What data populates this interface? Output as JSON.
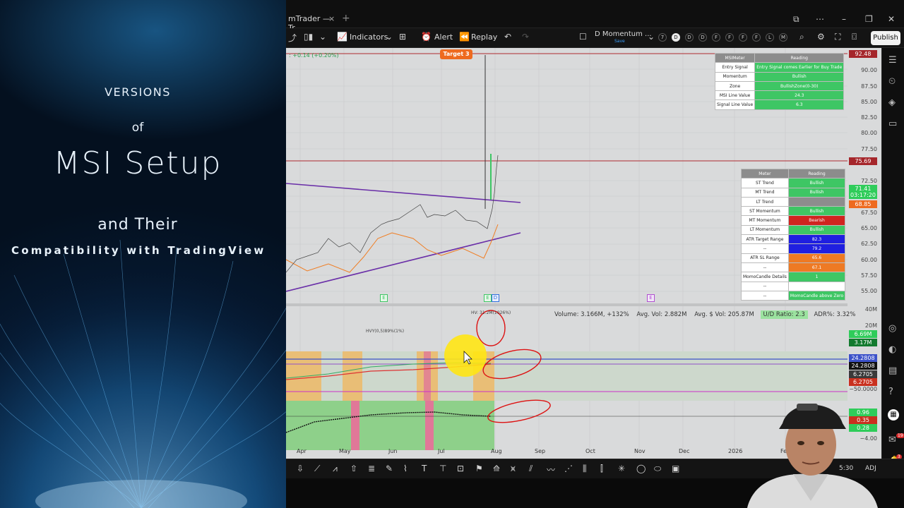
{
  "promo": {
    "line1": "VERSIONS",
    "line2": "of",
    "title": "MSI Setup",
    "line3": "and  Their",
    "line4": "Compatibility with TradingView"
  },
  "window": {
    "tab_title": "mTrader — Tr",
    "tab_close": "×",
    "new_tab": "+"
  },
  "toolbar": {
    "indicators_label": "Indicators",
    "alert_label": "Alert",
    "replay_label": "Replay",
    "layout_name": "D Momentum ...",
    "layout_sub": "Save",
    "timeframes": [
      "7",
      "D",
      "D",
      "D",
      "F",
      "F",
      "F",
      "F",
      "L",
      "M",
      "M"
    ],
    "publish_label": "Publish"
  },
  "chart": {
    "change_label": ": +0.14 (+0.20%)",
    "target_label": "Target 3",
    "price_scale": [
      "90.00",
      "87.50",
      "85.00",
      "82.50",
      "80.00",
      "77.50",
      "72.50",
      "67.50",
      "65.00",
      "62.50",
      "60.00",
      "57.50",
      "55.00"
    ],
    "price_tags": [
      {
        "text": "92.48",
        "color": "#a5262b"
      },
      {
        "text": "75.69",
        "color": "#a5262b"
      },
      {
        "text": "71.41",
        "color": "#2fcc5a"
      },
      {
        "text": "03:17:20",
        "color": "#2fcc5a"
      },
      {
        "text": "68.85",
        "color": "#ee6a1f"
      }
    ],
    "event_markers": [
      "E",
      "E",
      "D",
      "E"
    ],
    "volume_info": {
      "volume": "Volume: 3.166M, +132%",
      "avg_vol": "Avg. Vol: 2.882M",
      "avg_dollar": "Avg. $ Vol: 205.87M",
      "ud_ratio": "U/D Ratio: 2.3",
      "adr": "ADR%: 3.32%"
    },
    "hv_label_1": "HV: 31.2M(1026%)",
    "hv_label_2": "HVY(0,5)89%(1%)",
    "vol_scale": [
      "40M",
      "20M"
    ],
    "vol_tags": [
      "6.69M",
      "3.17M"
    ],
    "osc_tags": [
      "24.2808",
      "24.2808",
      "6.2705",
      "6.2705"
    ],
    "osc_scale": [
      "−50.0000"
    ],
    "osc2_tags": [
      "0.96",
      "0.35",
      "0.28"
    ],
    "osc2_scale": [
      "−4.00"
    ],
    "months": [
      "Apr",
      "May",
      "Jun",
      "Jul",
      "Aug",
      "Sep",
      "Oct",
      "Nov",
      "Dec",
      "2026",
      "Fe"
    ],
    "bottom_right": [
      "5:30",
      "ADJ"
    ]
  },
  "msimeter": {
    "header": [
      "MSIMeter",
      "Reading"
    ],
    "rows": [
      {
        "k": "Entry Signal",
        "v": "Entry Signal comes Earlier for Buy Trade",
        "c": "g"
      },
      {
        "k": "Momentum",
        "v": "Bullish",
        "c": "g"
      },
      {
        "k": "Zone",
        "v": "BullishZone(0-30)",
        "c": "g"
      },
      {
        "k": "MSI Line Value",
        "v": "24.3",
        "c": "g"
      },
      {
        "k": "Signal Line Value",
        "v": "6.3",
        "c": "g"
      }
    ]
  },
  "meter": {
    "header": [
      "Meter",
      "Reading"
    ],
    "rows": [
      {
        "k": "ST Trend",
        "v": "Bullish",
        "c": "g"
      },
      {
        "k": "MT Trend",
        "v": "Bullish",
        "c": "g"
      },
      {
        "k": "LT Trend",
        "v": "",
        "c": "gr"
      },
      {
        "k": "ST Momentum",
        "v": "Bullish",
        "c": "g"
      },
      {
        "k": "MT Momentum",
        "v": "Bearish",
        "c": "r"
      },
      {
        "k": "LT Momentum",
        "v": "Bullish",
        "c": "g"
      },
      {
        "k": "ATR Target Range",
        "v": "82.3",
        "c": "b"
      },
      {
        "k": "--",
        "v": "79.2",
        "c": "b"
      },
      {
        "k": "ATR SL Range",
        "v": "65.6",
        "c": "o"
      },
      {
        "k": "--",
        "v": "67.1",
        "c": "o"
      },
      {
        "k": "MomoCandle Details",
        "v": "1",
        "c": "g"
      },
      {
        "k": "--",
        "v": "",
        "c": "k"
      },
      {
        "k": "--",
        "v": "MomoCandle above Zero",
        "c": "g"
      }
    ]
  },
  "rightbar_badges": [
    "19",
    "3"
  ]
}
